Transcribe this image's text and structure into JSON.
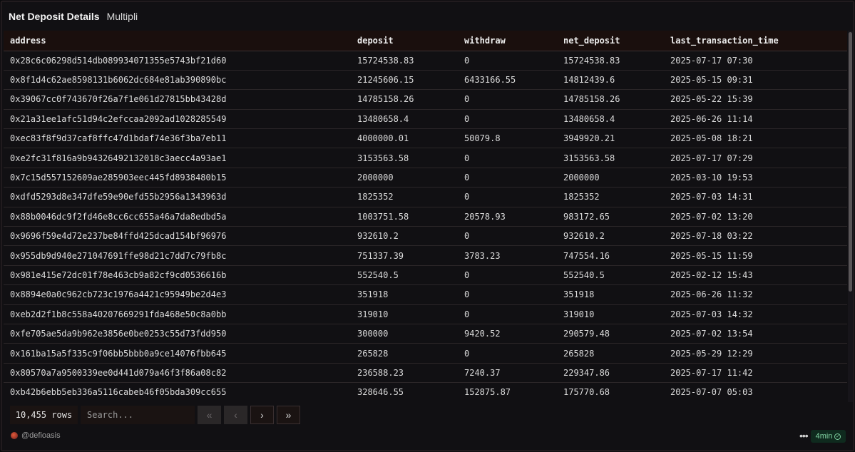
{
  "header": {
    "title": "Net Deposit Details",
    "subtitle": "Multipli"
  },
  "table": {
    "columns": [
      "address",
      "deposit",
      "withdraw",
      "net_deposit",
      "last_transaction_time"
    ],
    "rows": [
      [
        "0x28c6c06298d514db089934071355e5743bf21d60",
        "15724538.83",
        "0",
        "15724538.83",
        "2025-07-17 07:30"
      ],
      [
        "0x8f1d4c62ae8598131b6062dc684e81ab390890bc",
        "21245606.15",
        "6433166.55",
        "14812439.6",
        "2025-05-15 09:31"
      ],
      [
        "0x39067cc0f743670f26a7f1e061d27815bb43428d",
        "14785158.26",
        "0",
        "14785158.26",
        "2025-05-22 15:39"
      ],
      [
        "0x21a31ee1afc51d94c2efccaa2092ad1028285549",
        "13480658.4",
        "0",
        "13480658.4",
        "2025-06-26 11:14"
      ],
      [
        "0xec83f8f9d37caf8ffc47d1bdaf74e36f3ba7eb11",
        "4000000.01",
        "50079.8",
        "3949920.21",
        "2025-05-08 18:21"
      ],
      [
        "0xe2fc31f816a9b94326492132018c3aecc4a93ae1",
        "3153563.58",
        "0",
        "3153563.58",
        "2025-07-17 07:29"
      ],
      [
        "0x7c15d557152609ae285903eec445fd8938480b15",
        "2000000",
        "0",
        "2000000",
        "2025-03-10 19:53"
      ],
      [
        "0xdfd5293d8e347dfe59e90efd55b2956a1343963d",
        "1825352",
        "0",
        "1825352",
        "2025-07-03 14:31"
      ],
      [
        "0x88b0046dc9f2fd46e8cc6cc655a46a7da8edbd5a",
        "1003751.58",
        "20578.93",
        "983172.65",
        "2025-07-02 13:20"
      ],
      [
        "0x9696f59e4d72e237be84ffd425dcad154bf96976",
        "932610.2",
        "0",
        "932610.2",
        "2025-07-18 03:22"
      ],
      [
        "0x955db9d940e271047691ffe98d21c7dd7c79fb8c",
        "751337.39",
        "3783.23",
        "747554.16",
        "2025-05-15 11:59"
      ],
      [
        "0x981e415e72dc01f78e463cb9a82cf9cd0536616b",
        "552540.5",
        "0",
        "552540.5",
        "2025-02-12 15:43"
      ],
      [
        "0x8894e0a0c962cb723c1976a4421c95949be2d4e3",
        "351918",
        "0",
        "351918",
        "2025-06-26 11:32"
      ],
      [
        "0xeb2d2f1b8c558a40207669291fda468e50c8a0bb",
        "319010",
        "0",
        "319010",
        "2025-07-03 14:32"
      ],
      [
        "0xfe705ae5da9b962e3856e0be0253c55d73fdd950",
        "300000",
        "9420.52",
        "290579.48",
        "2025-07-02 13:54"
      ],
      [
        "0x161ba15a5f335c9f06bb5bbb0a9ce14076fbb645",
        "265828",
        "0",
        "265828",
        "2025-05-29 12:29"
      ],
      [
        "0x80570a7a9500339ee0d441d079a46f3f86a08c82",
        "236588.23",
        "7240.37",
        "229347.86",
        "2025-07-17 11:42"
      ],
      [
        "0xb42b6ebb5eb336a5116cabeb46f05bda309cc655",
        "328646.55",
        "152875.87",
        "175770.68",
        "2025-07-07 05:03"
      ]
    ]
  },
  "pagination": {
    "rows_count": "10,455 rows",
    "search_placeholder": "Search...",
    "first": "«",
    "prev": "‹",
    "next": "›",
    "last": "»"
  },
  "footer": {
    "credit": "@defioasis",
    "menu": "•••",
    "refresh": "4min"
  }
}
